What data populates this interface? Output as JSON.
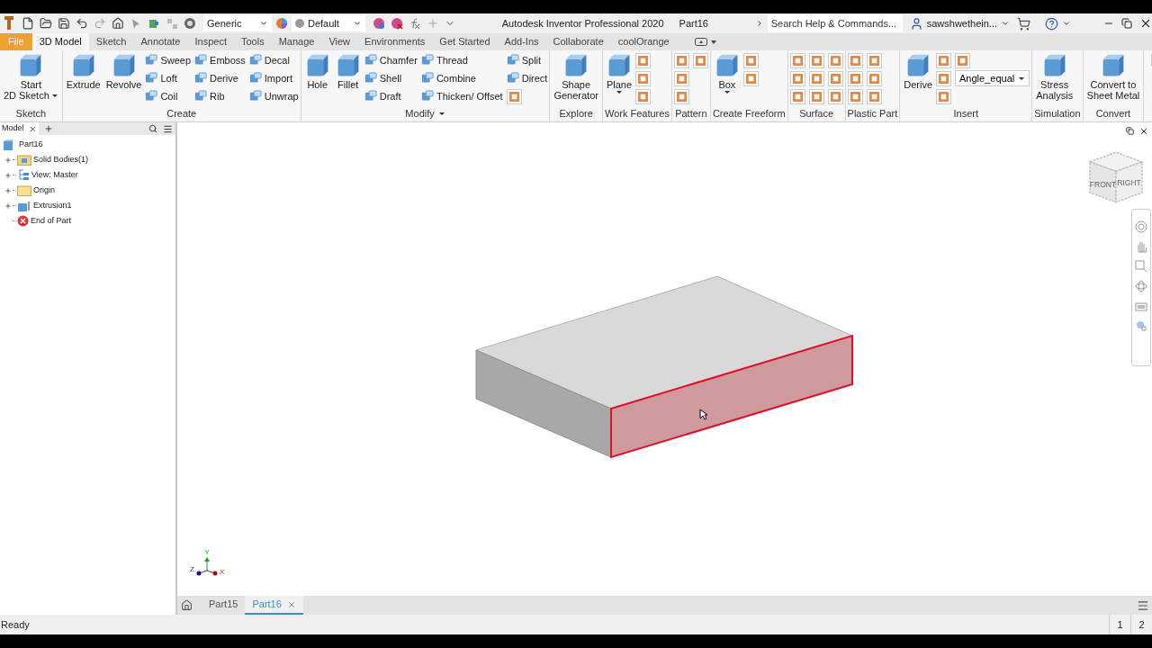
{
  "quick_access": {
    "appearance": "Generic",
    "style": "Default"
  },
  "title": {
    "app": "Autodesk Inventor Professional 2020",
    "document": "Part16"
  },
  "search": {
    "placeholder": "Search Help & Commands..."
  },
  "user": {
    "name": "sawshwethein..."
  },
  "tabs": [
    {
      "label": "File",
      "kind": "file",
      "selected": false
    },
    {
      "label": "3D Model",
      "kind": "tab",
      "selected": true
    },
    {
      "label": "Sketch",
      "kind": "tab",
      "selected": false
    },
    {
      "label": "Annotate",
      "kind": "tab",
      "selected": false
    },
    {
      "label": "Inspect",
      "kind": "tab",
      "selected": false
    },
    {
      "label": "Tools",
      "kind": "tab",
      "selected": false
    },
    {
      "label": "Manage",
      "kind": "tab",
      "selected": false
    },
    {
      "label": "View",
      "kind": "tab",
      "selected": false
    },
    {
      "label": "Environments",
      "kind": "tab",
      "selected": false
    },
    {
      "label": "Get Started",
      "kind": "tab",
      "selected": false
    },
    {
      "label": "Add-Ins",
      "kind": "tab",
      "selected": false
    },
    {
      "label": "Collaborate",
      "kind": "tab",
      "selected": false
    },
    {
      "label": "coolOrange",
      "kind": "tab",
      "selected": false
    }
  ],
  "ribbon": [
    {
      "label": "Sketch",
      "menu": false,
      "items": [
        {
          "kind": "large",
          "lines": [
            "Start",
            "2D Sketch"
          ],
          "has_menu": true
        }
      ]
    },
    {
      "label": "Create",
      "menu": false,
      "items": [
        {
          "kind": "large",
          "lines": [
            "Extrude"
          ],
          "has_menu": false
        },
        {
          "kind": "large",
          "lines": [
            "Revolve"
          ],
          "has_menu": false
        },
        {
          "kind": "small",
          "label": "Sweep"
        },
        {
          "kind": "small",
          "label": "Loft"
        },
        {
          "kind": "small",
          "label": "Coil"
        },
        {
          "kind": "small",
          "label": "Emboss"
        },
        {
          "kind": "small",
          "label": "Derive"
        },
        {
          "kind": "small",
          "label": "Rib"
        },
        {
          "kind": "small",
          "label": "Decal"
        },
        {
          "kind": "small",
          "label": "Import"
        },
        {
          "kind": "small",
          "label": "Unwrap"
        }
      ]
    },
    {
      "label": "Modify",
      "menu": true,
      "items": [
        {
          "kind": "large",
          "lines": [
            "Hole"
          ],
          "has_menu": false
        },
        {
          "kind": "large",
          "lines": [
            "Fillet"
          ],
          "has_menu": false
        },
        {
          "kind": "small",
          "label": "Chamfer"
        },
        {
          "kind": "small",
          "label": "Shell"
        },
        {
          "kind": "small",
          "label": "Draft"
        },
        {
          "kind": "small",
          "label": "Thread"
        },
        {
          "kind": "small",
          "label": "Combine"
        },
        {
          "kind": "small",
          "label": "Thicken/ Offset"
        },
        {
          "kind": "small",
          "label": "Split"
        },
        {
          "kind": "small",
          "label": "Direct"
        },
        {
          "kind": "icon"
        }
      ]
    },
    {
      "label": "Explore",
      "menu": false,
      "items": [
        {
          "kind": "large",
          "lines": [
            "Shape",
            "Generator"
          ],
          "has_menu": false
        }
      ]
    },
    {
      "label": "Work Features",
      "menu": false,
      "items": [
        {
          "kind": "large",
          "lines": [
            "Plane"
          ],
          "has_menu": true
        },
        {
          "kind": "icon"
        },
        {
          "kind": "icon"
        },
        {
          "kind": "icon"
        }
      ]
    },
    {
      "label": "Pattern",
      "menu": false,
      "items": [
        {
          "kind": "icon"
        },
        {
          "kind": "icon"
        },
        {
          "kind": "icon"
        },
        {
          "kind": "icon"
        }
      ]
    },
    {
      "label": "Create Freeform",
      "menu": false,
      "items": [
        {
          "kind": "large",
          "lines": [
            "Box"
          ],
          "has_menu": true
        },
        {
          "kind": "icon"
        },
        {
          "kind": "icon"
        }
      ]
    },
    {
      "label": "Surface",
      "menu": false,
      "items": [
        {
          "kind": "icon"
        },
        {
          "kind": "icon"
        },
        {
          "kind": "icon"
        },
        {
          "kind": "icon"
        },
        {
          "kind": "icon"
        },
        {
          "kind": "icon"
        },
        {
          "kind": "icon"
        },
        {
          "kind": "icon"
        },
        {
          "kind": "icon"
        }
      ]
    },
    {
      "label": "Plastic Part",
      "menu": false,
      "items": [
        {
          "kind": "icon"
        },
        {
          "kind": "icon"
        },
        {
          "kind": "icon"
        },
        {
          "kind": "icon"
        },
        {
          "kind": "icon"
        },
        {
          "kind": "icon"
        }
      ]
    },
    {
      "label": "Insert",
      "menu": false,
      "items": [
        {
          "kind": "large",
          "lines": [
            "Derive"
          ],
          "has_menu": false
        },
        {
          "kind": "icon"
        },
        {
          "kind": "icon"
        },
        {
          "kind": "icon"
        },
        {
          "kind": "icon"
        },
        {
          "kind": "dropdown",
          "value": "Angle_equal"
        }
      ]
    },
    {
      "label": "Simulation",
      "menu": false,
      "items": [
        {
          "kind": "large",
          "lines": [
            "Stress",
            "Analysis"
          ],
          "has_menu": false
        }
      ]
    },
    {
      "label": "Convert",
      "menu": false,
      "items": [
        {
          "kind": "large",
          "lines": [
            "Convert to",
            "Sheet Metal"
          ],
          "has_menu": false
        }
      ]
    }
  ],
  "browser": {
    "tab": "Model",
    "tree": {
      "label": "Part16",
      "kind": "part",
      "children": [
        {
          "label": "Solid Bodies(1)",
          "kind": "bodies",
          "expanded": false
        },
        {
          "label": "View: Master",
          "kind": "view",
          "expanded": false
        },
        {
          "label": "Origin",
          "kind": "folder",
          "expanded": false
        },
        {
          "label": "Extrusion1",
          "kind": "extrusion",
          "expanded": false
        },
        {
          "label": "End of Part",
          "kind": "end"
        }
      ]
    }
  },
  "viewport": {
    "face_highlighted": true,
    "viewcube": [
      "FRONT",
      "RIGHT"
    ],
    "axes": [
      "Y",
      "Z",
      "X"
    ]
  },
  "document_tabs": [
    {
      "label": "Part15",
      "selected": false
    },
    {
      "label": "Part16",
      "selected": true
    }
  ],
  "status_bar": {
    "text": "Ready",
    "pages": [
      "1",
      "2"
    ]
  }
}
